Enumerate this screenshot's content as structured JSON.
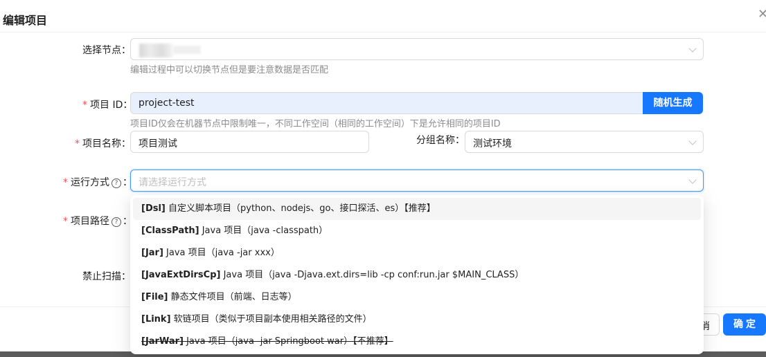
{
  "modal": {
    "title": "编辑项目",
    "close_icon": "close-icon"
  },
  "form": {
    "node": {
      "label": "选择节点",
      "colon": "：",
      "hint": "编辑过程中可以切换节点但是要注意数据是否匹配"
    },
    "project_id": {
      "required_mark": "*",
      "label": "项目 ID",
      "colon": "：",
      "value": "project-test",
      "random_button": "随机生成",
      "hint": "项目ID仅会在机器节点中限制唯一，不同工作空间（相同的工作空间）下是允许相同的项目ID"
    },
    "project_name": {
      "required_mark": "*",
      "label": "项目名称",
      "colon": "：",
      "value": "项目测试"
    },
    "group_name": {
      "label": "分组名称",
      "colon": "：",
      "value": "测试环境"
    },
    "run_mode": {
      "required_mark": "*",
      "label": "运行方式",
      "colon": "：",
      "help_icon": "question-circle-icon",
      "placeholder": "请选择运行方式"
    },
    "project_path": {
      "required_mark": "*",
      "label": "项目路径",
      "colon": "：",
      "help_icon": "question-circle-icon"
    },
    "disable_scan": {
      "label": "禁止扫描",
      "colon": "："
    }
  },
  "run_mode_options": [
    {
      "key": "[Dsl]",
      "desc": " 自定义脚本项目（python、nodejs、go、接口探活、es）【推荐】",
      "active": true,
      "deprecated": false
    },
    {
      "key": "[ClassPath]",
      "desc": " Java 项目（java -classpath）",
      "active": false,
      "deprecated": false
    },
    {
      "key": "[Jar]",
      "desc": " Java 项目（java -jar xxx）",
      "active": false,
      "deprecated": false
    },
    {
      "key": "[JavaExtDirsCp]",
      "desc": " Java 项目（java -Djava.ext.dirs=lib -cp conf:run.jar $MAIN_CLASS）",
      "active": false,
      "deprecated": false
    },
    {
      "key": "[File]",
      "desc": " 静态文件项目（前端、日志等）",
      "active": false,
      "deprecated": false
    },
    {
      "key": "[Link]",
      "desc": " 软链项目（类似于项目副本使用相关路径的文件）",
      "active": false,
      "deprecated": false
    },
    {
      "key": "[JarWar]",
      "desc": " Java 项目（java -jar Springboot war）【不推荐】",
      "active": false,
      "deprecated": true
    }
  ],
  "footer": {
    "cancel_label": "消",
    "ok_label": "确定"
  }
}
